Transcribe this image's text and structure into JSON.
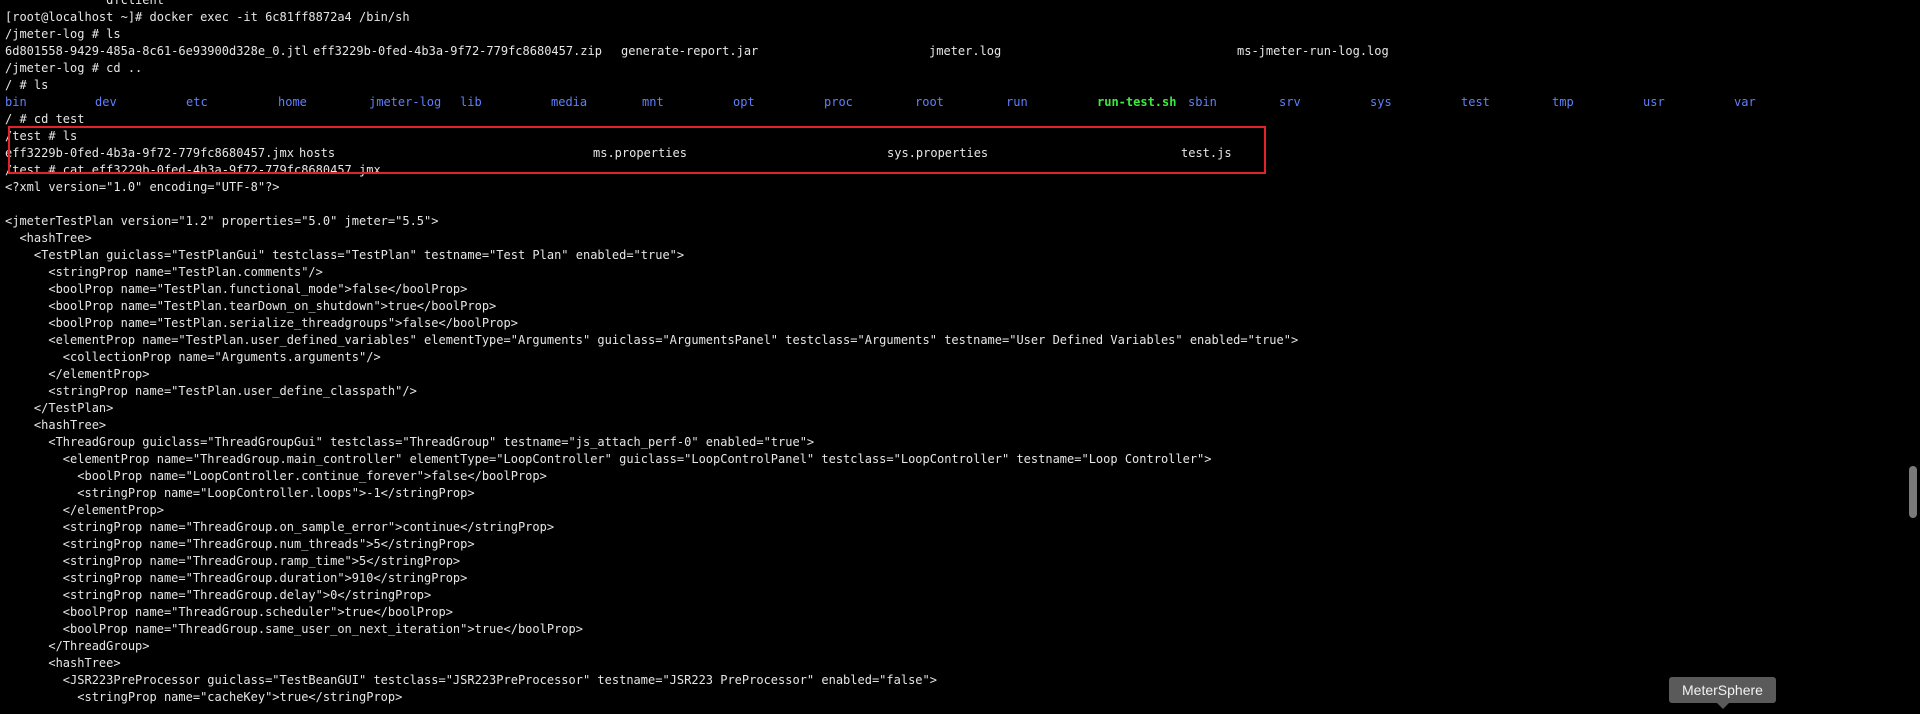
{
  "terminal": {
    "lines_before": [
      "              dfclient",
      "[root@localhost ~]# docker exec -it 6c81ff8872a4 /bin/sh",
      "/jmeter-log # ls"
    ],
    "jmeter_log_ls": [
      "6d801558-9429-485a-8c61-6e93900d328e_0.jtl",
      "eff3229b-0fed-4b3a-9f72-779fc8680457.zip",
      "generate-report.jar",
      "jmeter.log",
      "ms-jmeter-run-log.log"
    ],
    "cd_up": "/jmeter-log # cd ..",
    "root_ls_cmd": "/ # ls",
    "root_ls": [
      {
        "name": "bin",
        "kind": "dir"
      },
      {
        "name": "dev",
        "kind": "dir"
      },
      {
        "name": "etc",
        "kind": "dir"
      },
      {
        "name": "home",
        "kind": "dir"
      },
      {
        "name": "jmeter-log",
        "kind": "dir"
      },
      {
        "name": "lib",
        "kind": "dir"
      },
      {
        "name": "media",
        "kind": "dir"
      },
      {
        "name": "mnt",
        "kind": "dir"
      },
      {
        "name": "opt",
        "kind": "dir"
      },
      {
        "name": "proc",
        "kind": "dir"
      },
      {
        "name": "root",
        "kind": "dir"
      },
      {
        "name": "run",
        "kind": "dir"
      },
      {
        "name": "run-test.sh",
        "kind": "exec"
      },
      {
        "name": "sbin",
        "kind": "dir"
      },
      {
        "name": "srv",
        "kind": "dir"
      },
      {
        "name": "sys",
        "kind": "dir"
      },
      {
        "name": "test",
        "kind": "dir"
      },
      {
        "name": "tmp",
        "kind": "dir"
      },
      {
        "name": "usr",
        "kind": "dir"
      },
      {
        "name": "var",
        "kind": "dir"
      }
    ],
    "cd_test": "/ # cd test",
    "test_ls_cmd": "/test # ls",
    "test_ls": [
      "eff3229b-0fed-4b3a-9f72-779fc8680457.jmx",
      "hosts",
      "ms.properties",
      "sys.properties",
      "test.js"
    ],
    "cat_cmd": "/test # cat eff3229b-0fed-4b3a-9f72-779fc8680457.jmx",
    "xml_lines": [
      "<?xml version=\"1.0\" encoding=\"UTF-8\"?>",
      "",
      "<jmeterTestPlan version=\"1.2\" properties=\"5.0\" jmeter=\"5.5\">",
      "  <hashTree>",
      "    <TestPlan guiclass=\"TestPlanGui\" testclass=\"TestPlan\" testname=\"Test Plan\" enabled=\"true\">",
      "      <stringProp name=\"TestPlan.comments\"/>",
      "      <boolProp name=\"TestPlan.functional_mode\">false</boolProp>",
      "      <boolProp name=\"TestPlan.tearDown_on_shutdown\">true</boolProp>",
      "      <boolProp name=\"TestPlan.serialize_threadgroups\">false</boolProp>",
      "      <elementProp name=\"TestPlan.user_defined_variables\" elementType=\"Arguments\" guiclass=\"ArgumentsPanel\" testclass=\"Arguments\" testname=\"User Defined Variables\" enabled=\"true\">",
      "        <collectionProp name=\"Arguments.arguments\"/>",
      "      </elementProp>",
      "      <stringProp name=\"TestPlan.user_define_classpath\"/>",
      "    </TestPlan>",
      "    <hashTree>",
      "      <ThreadGroup guiclass=\"ThreadGroupGui\" testclass=\"ThreadGroup\" testname=\"js_attach_perf-0\" enabled=\"true\">",
      "        <elementProp name=\"ThreadGroup.main_controller\" elementType=\"LoopController\" guiclass=\"LoopControlPanel\" testclass=\"LoopController\" testname=\"Loop Controller\">",
      "          <boolProp name=\"LoopController.continue_forever\">false</boolProp>",
      "          <stringProp name=\"LoopController.loops\">-1</stringProp>",
      "        </elementProp>",
      "        <stringProp name=\"ThreadGroup.on_sample_error\">continue</stringProp>",
      "        <stringProp name=\"ThreadGroup.num_threads\">5</stringProp>",
      "        <stringProp name=\"ThreadGroup.ramp_time\">5</stringProp>",
      "        <stringProp name=\"ThreadGroup.duration\">910</stringProp>",
      "        <stringProp name=\"ThreadGroup.delay\">0</stringProp>",
      "        <boolProp name=\"ThreadGroup.scheduler\">true</boolProp>",
      "        <boolProp name=\"ThreadGroup.same_user_on_next_iteration\">true</boolProp>",
      "      </ThreadGroup>",
      "      <hashTree>",
      "        <JSR223PreProcessor guiclass=\"TestBeanGUI\" testclass=\"JSR223PreProcessor\" testname=\"JSR223 PreProcessor\" enabled=\"false\">",
      "          <stringProp name=\"cacheKey\">true</stringProp>"
    ]
  },
  "tooltip": {
    "label": "MeterSphere"
  },
  "colors": {
    "background": "#000000",
    "text": "#e6e6e6",
    "directory": "#5f7fff",
    "executable": "#3ee83e",
    "highlight_box": "#e0222a"
  }
}
